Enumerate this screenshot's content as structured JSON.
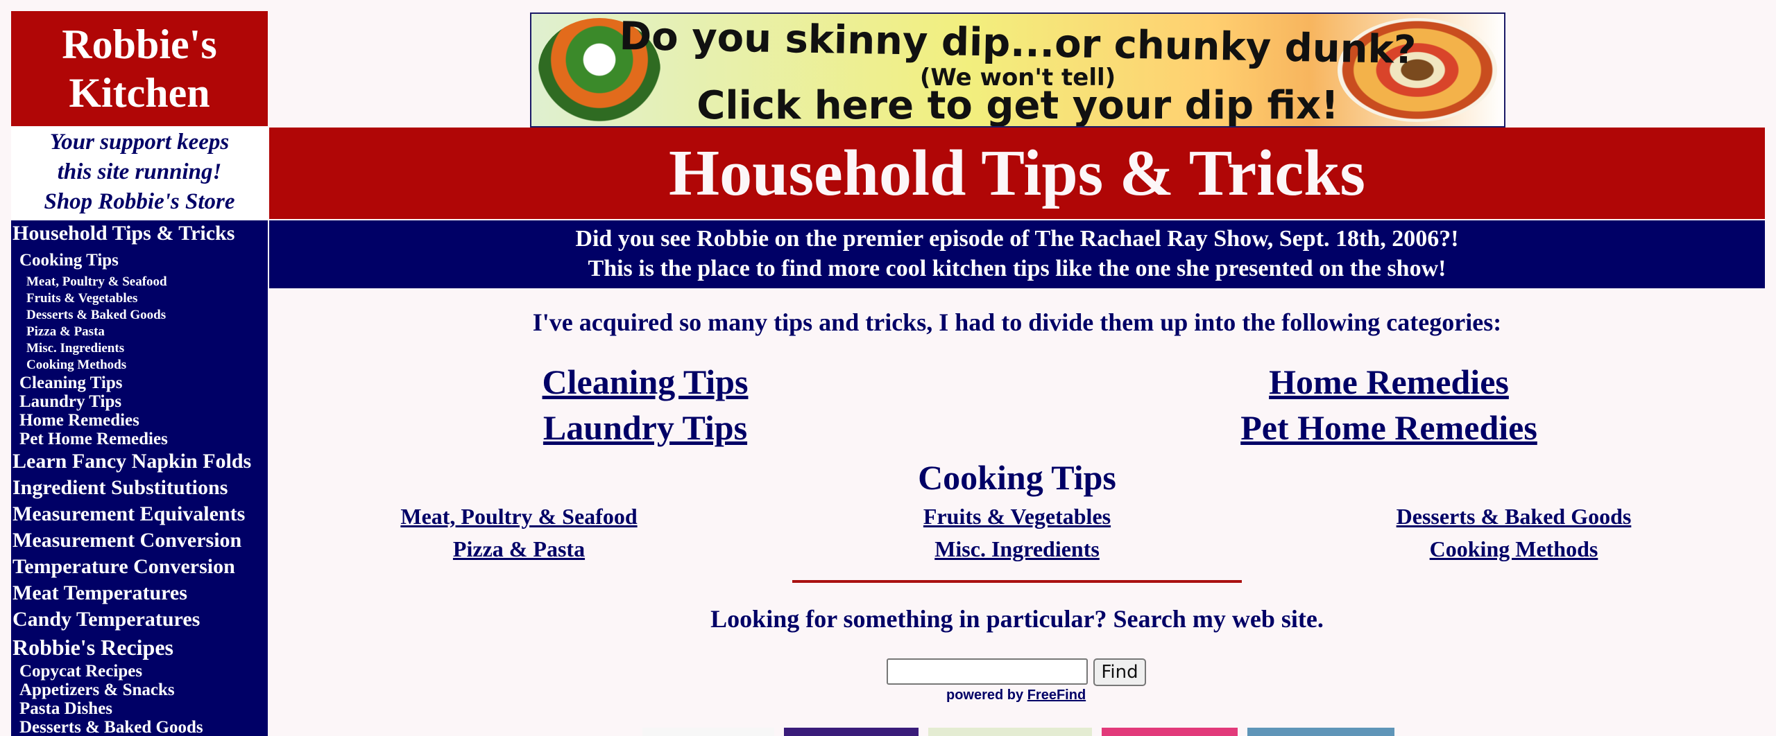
{
  "sidebar": {
    "logo_line1": "Robbie's",
    "logo_line2": "Kitchen",
    "support_line1": "Your support keeps",
    "support_line2": "this site running!",
    "support_line3": "Shop Robbie's Store",
    "nav": {
      "household": "Household Tips & Tricks",
      "cooking_tips": "Cooking Tips",
      "meat": "Meat, Poultry & Seafood",
      "fruits": "Fruits & Vegetables",
      "desserts": "Desserts & Baked Goods",
      "pizza": "Pizza & Pasta",
      "misc": "Misc. Ingredients",
      "methods": "Cooking Methods",
      "cleaning": "Cleaning Tips",
      "laundry": "Laundry Tips",
      "remedies": "Home Remedies",
      "pet": "Pet Home Remedies",
      "napkin": "Learn Fancy Napkin Folds",
      "substitutions": "Ingredient Substitutions",
      "equivalents": "Measurement Equivalents",
      "conversion": "Measurement Conversion",
      "temperature": "Temperature Conversion",
      "meat_temps": "Meat Temperatures",
      "candy_temps": "Candy Temperatures",
      "recipes": "Robbie's Recipes",
      "copycat": "Copycat Recipes",
      "appetizers": "Appetizers & Snacks",
      "pasta_dishes": "Pasta Dishes",
      "desserts_baked": "Desserts & Baked Goods"
    }
  },
  "ad": {
    "line1": "Do you skinny dip...or chunky dunk?",
    "line2": "(We won't tell)",
    "line3": "Click here to get your dip fix!"
  },
  "header": {
    "title": "Household Tips & Tricks",
    "promo_line1": "Did you see Robbie on the premier episode of The Rachael Ray Show, Sept. 18th, 2006?!",
    "promo_line2": "This is the place to find more cool kitchen tips like the one she presented on the show!"
  },
  "main": {
    "intro": "I've acquired so many tips and tricks, I had to divide them up into the following categories:",
    "links": {
      "cleaning": "Cleaning Tips",
      "remedies": "Home Remedies",
      "laundry": "Laundry Tips",
      "pet": "Pet Home Remedies"
    },
    "cooking_heading": "Cooking Tips",
    "cooking_links": {
      "meat": "Meat, Poultry & Seafood",
      "fruits": "Fruits & Vegetables",
      "desserts": "Desserts & Baked Goods",
      "pizza": "Pizza & Pasta",
      "misc": "Misc. Ingredients",
      "methods": "Cooking Methods"
    }
  },
  "search": {
    "prompt": "Looking for something in particular? Search my web site.",
    "input_value": "",
    "button": "Find",
    "powered_by": "powered by",
    "powered_link": "FreeFind"
  },
  "colors": {
    "red": "#b00606",
    "navy": "#000066",
    "background": "#fcf6f8"
  }
}
